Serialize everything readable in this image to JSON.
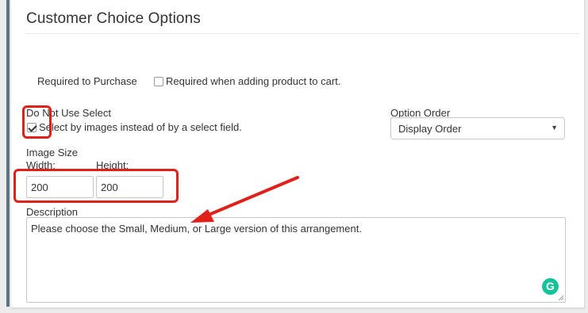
{
  "section": {
    "title": "Customer Choice Options"
  },
  "required": {
    "label": "Required to Purchase",
    "checkbox_label": "Required when adding product to cart.",
    "checked": false
  },
  "do_not_use_select": {
    "label": "Do Not Use Select",
    "checkbox_label": "Select by images instead of by a select field.",
    "checked": true
  },
  "option_order": {
    "label": "Option Order",
    "selected": "Display Order",
    "caret_icon": "chevron-down-icon"
  },
  "image_size": {
    "label": "Image Size",
    "width_label": "Width:",
    "height_label": "Height:",
    "width_value": "200",
    "height_value": "200"
  },
  "description": {
    "label": "Description",
    "value": "Please choose the Small, Medium, or Large version of this arrangement.",
    "assistant_icon": "grammarly-icon",
    "assistant_glyph": "G"
  },
  "annotations": {
    "highlight_color": "#e0201b"
  }
}
